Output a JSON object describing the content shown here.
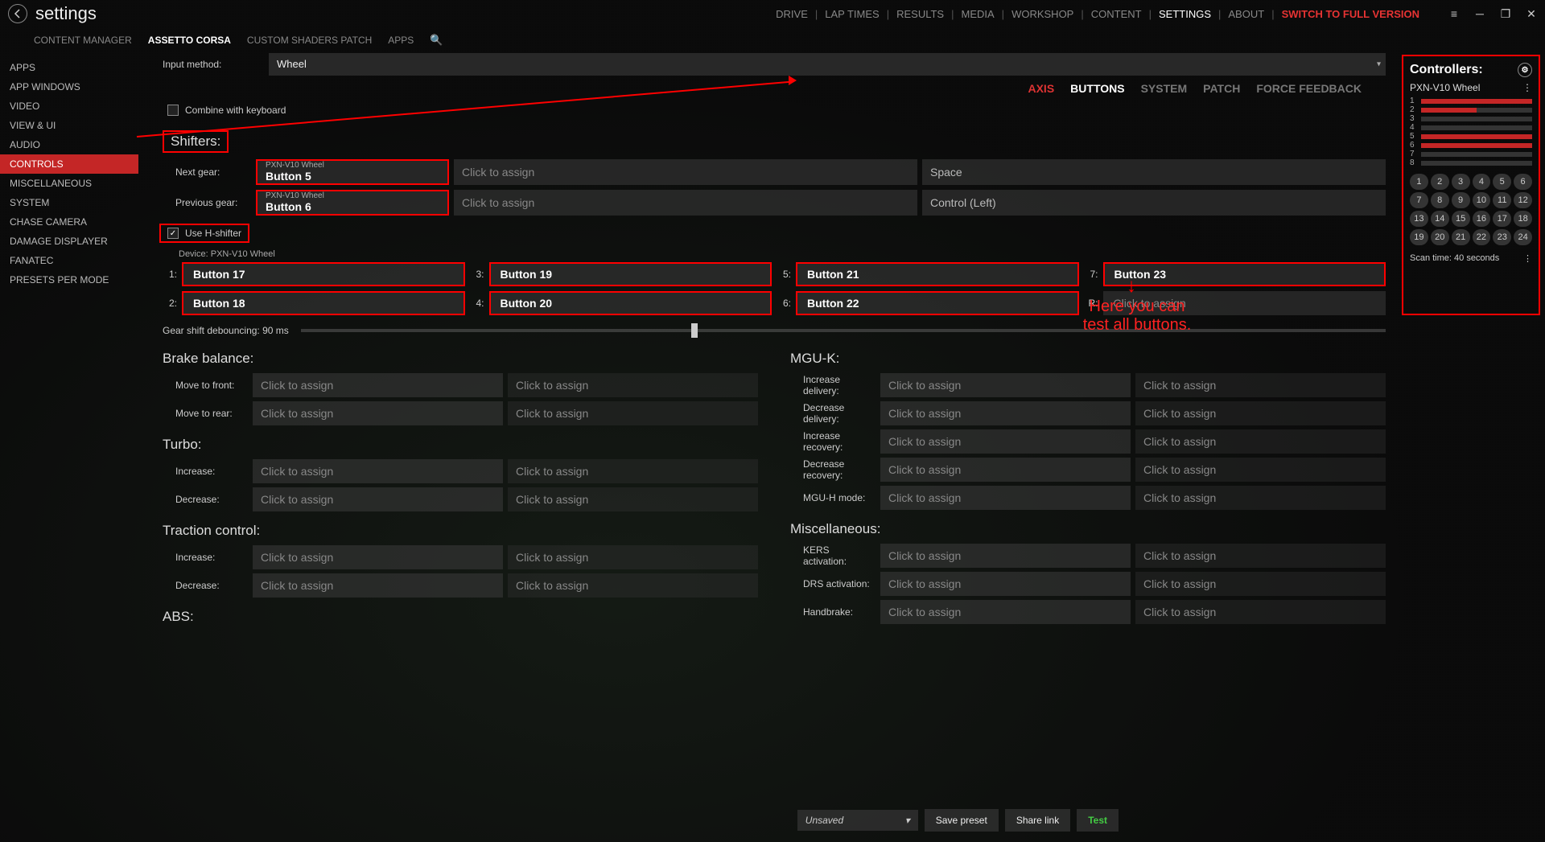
{
  "title": "settings",
  "topnav": {
    "items": [
      "DRIVE",
      "LAP TIMES",
      "RESULTS",
      "MEDIA",
      "WORKSHOP",
      "CONTENT",
      "SETTINGS",
      "ABOUT"
    ],
    "active": "SETTINGS",
    "switch": "SWITCH TO FULL VERSION"
  },
  "subnav": {
    "items": [
      "CONTENT MANAGER",
      "ASSETTO CORSA",
      "CUSTOM SHADERS PATCH",
      "APPS"
    ],
    "active": "ASSETTO CORSA"
  },
  "sidebar": {
    "items": [
      "APPS",
      "APP WINDOWS",
      "VIDEO",
      "VIEW & UI",
      "AUDIO",
      "CONTROLS",
      "MISCELLANEOUS",
      "SYSTEM",
      "CHASE CAMERA",
      "DAMAGE DISPLAYER",
      "FANATEC",
      "PRESETS PER MODE"
    ],
    "active": "CONTROLS"
  },
  "input_method": {
    "label": "Input method:",
    "value": "Wheel"
  },
  "tabs2": {
    "items": [
      "AXIS",
      "BUTTONS",
      "SYSTEM",
      "PATCH",
      "FORCE FEEDBACK"
    ],
    "active": "BUTTONS"
  },
  "combine": {
    "label": "Combine with keyboard",
    "checked": false
  },
  "shifters": {
    "title": "Shifters:",
    "next": {
      "label": "Next gear:",
      "device": "PXN-V10 Wheel",
      "value": "Button 5",
      "alt2": "Click to assign",
      "alt3": "Space"
    },
    "prev": {
      "label": "Previous gear:",
      "device": "PXN-V10 Wheel",
      "value": "Button 6",
      "alt2": "Click to assign",
      "alt3": "Control (Left)"
    },
    "use_h": {
      "label": "Use H-shifter",
      "checked": true
    },
    "device_label": "Device: PXN-V10 Wheel",
    "cells": [
      {
        "n": "1:",
        "v": "Button 17"
      },
      {
        "n": "3:",
        "v": "Button 19"
      },
      {
        "n": "5:",
        "v": "Button 21"
      },
      {
        "n": "7:",
        "v": "Button 23"
      },
      {
        "n": "2:",
        "v": "Button 18"
      },
      {
        "n": "4:",
        "v": "Button 20"
      },
      {
        "n": "6:",
        "v": "Button 22"
      },
      {
        "n": "R:",
        "v": "Click to assign"
      }
    ],
    "debounce": {
      "label": "Gear shift debouncing: 90 ms"
    }
  },
  "brake": {
    "title": "Brake balance:",
    "rows": [
      {
        "label": "Move to front:",
        "p": "Click to assign"
      },
      {
        "label": "Move to rear:",
        "p": "Click to assign"
      }
    ]
  },
  "turbo": {
    "title": "Turbo:",
    "rows": [
      {
        "label": "Increase:",
        "p": "Click to assign"
      },
      {
        "label": "Decrease:",
        "p": "Click to assign"
      }
    ]
  },
  "tc": {
    "title": "Traction control:",
    "rows": [
      {
        "label": "Increase:",
        "p": "Click to assign"
      },
      {
        "label": "Decrease:",
        "p": "Click to assign"
      }
    ]
  },
  "abs": {
    "title": "ABS:"
  },
  "mguk": {
    "title": "MGU-K:",
    "rows": [
      {
        "label": "Increase delivery:",
        "p": "Click to assign"
      },
      {
        "label": "Decrease delivery:",
        "p": "Click to assign"
      },
      {
        "label": "Increase recovery:",
        "p": "Click to assign"
      },
      {
        "label": "Decrease recovery:",
        "p": "Click to assign"
      },
      {
        "label": "MGU-H mode:",
        "p": "Click to assign"
      }
    ]
  },
  "misc": {
    "title": "Miscellaneous:",
    "rows": [
      {
        "label": "KERS activation:",
        "p": "Click to assign"
      },
      {
        "label": "DRS activation:",
        "p": "Click to assign"
      },
      {
        "label": "Handbrake:",
        "p": "Click to assign"
      }
    ]
  },
  "controllers": {
    "title": "Controllers:",
    "name": "PXN-V10 Wheel",
    "axes": [
      {
        "n": "1",
        "fill": 100
      },
      {
        "n": "2",
        "fill": 50
      },
      {
        "n": "3",
        "fill": 0
      },
      {
        "n": "4",
        "fill": 0
      },
      {
        "n": "5",
        "fill": 100
      },
      {
        "n": "6",
        "fill": 100
      },
      {
        "n": "7",
        "fill": 0
      },
      {
        "n": "8",
        "fill": 0
      }
    ],
    "buttons": [
      "1",
      "2",
      "3",
      "4",
      "5",
      "6",
      "7",
      "8",
      "9",
      "10",
      "11",
      "12",
      "13",
      "14",
      "15",
      "16",
      "17",
      "18",
      "19",
      "20",
      "21",
      "22",
      "23",
      "24"
    ],
    "scan": "Scan time: 40 seconds"
  },
  "footer": {
    "preset": "Unsaved",
    "save": "Save preset",
    "share": "Share link",
    "test": "Test"
  },
  "annotation": "Here you can\ntest all buttons.",
  "click_to_assign": "Click to assign"
}
